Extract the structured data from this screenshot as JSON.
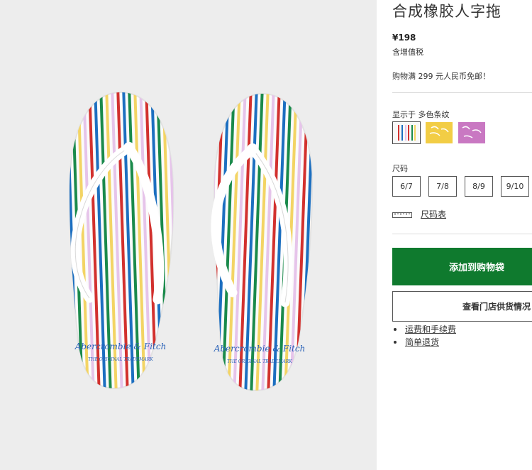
{
  "product": {
    "title": "合成橡胶人字拖",
    "price": "¥198",
    "tax_note": "含增值税",
    "free_shipping": "购物满 299 元人民币免邮！",
    "image_brand_text": "Abercrombie & Fitch",
    "image_brand_tagline": "THE ORIGINAL TRADEMARK"
  },
  "color": {
    "label": "显示于 多色条纹",
    "swatches": [
      {
        "name": "多色条纹",
        "selected": true
      },
      {
        "name": "黄色",
        "selected": false,
        "color": "#f2cd45"
      },
      {
        "name": "紫色",
        "selected": false,
        "color": "#c978c2"
      }
    ]
  },
  "size": {
    "label": "尺码",
    "options": [
      "6/7",
      "7/8",
      "8/9",
      "9/10"
    ],
    "chart_label": "尺码表"
  },
  "actions": {
    "add_to_bag": "添加到购物袋",
    "store_stock": "查看门店供货情况"
  },
  "links": {
    "shipping": "运费和手续费",
    "returns": "简单退货"
  },
  "colors": {
    "accent_green": "#0f7a2e",
    "stripes": [
      "#d2312e",
      "#1c6fc0",
      "#1a8a4b",
      "#f3d464",
      "#e6c4ea"
    ]
  }
}
